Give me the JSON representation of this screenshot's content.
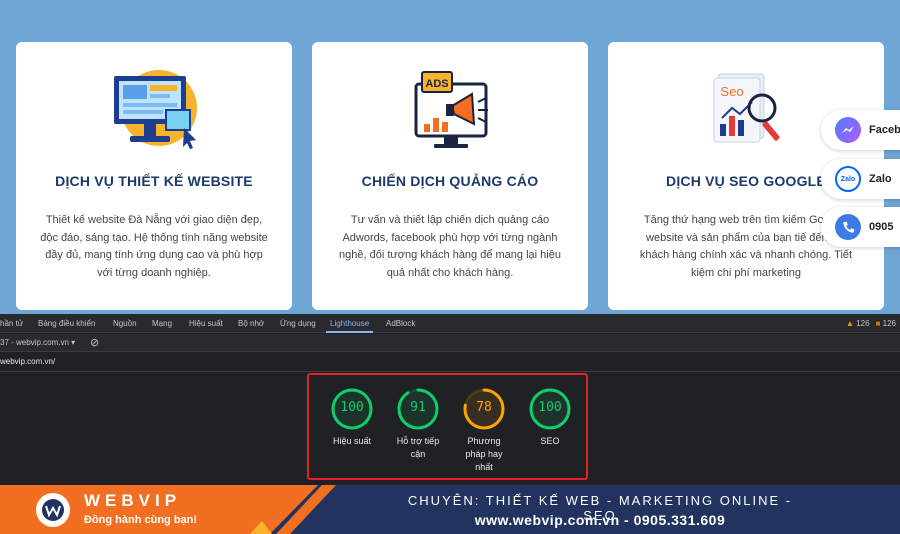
{
  "cards": [
    {
      "title": "DỊCH VỤ THIẾT KẾ WEBSITE",
      "desc": "Thiết kế website Đà Nẵng với giao diện đẹp, độc đáo, sáng tạo. Hệ thống tính năng website đầy đủ, mang tính ứng dụng cao và phù hợp với từng doanh nghiệp.",
      "icon": "monitor-website-icon"
    },
    {
      "title": "CHIẾN DỊCH QUẢNG CÁO",
      "desc": "Tư vấn và thiết lập chiến dịch quảng cáo Adwords, facebook phù hợp với từng ngành nghề, đối tượng khách hàng để mang lại hiệu quả nhất cho khách hàng.",
      "icon": "ads-megaphone-icon",
      "icon_text": "ADS"
    },
    {
      "title": "DỊCH VỤ SEO GOOGLE",
      "desc": "Tăng thứ hạng web trên tìm kiếm Go Đưa website và sản phẩm của bạn tiế đến tệp khách hàng chính xác và nhanh chóng. Tiết kiệm chi phí marketing",
      "icon": "seo-magnifier-icon",
      "icon_text": "Seo"
    }
  ],
  "contacts": {
    "facebook": "Faceb",
    "zalo": "Zalo",
    "zalo_icon_text": "Zalo",
    "phone": "0905"
  },
  "devtools": {
    "tabs": [
      "hần tử",
      "Bảng điều khiển",
      "Nguồn",
      "Mạng",
      "Hiệu suất",
      "Bộ nhớ",
      "Ứng dụng",
      "Lighthouse",
      "AdBlock"
    ],
    "active_tab": "Lighthouse",
    "warnings": "126",
    "messages": "126",
    "report_select": "37 - webvip.com.vn",
    "url": "webvip.com.vn/",
    "scores": [
      {
        "label": "Hiệu suất",
        "value": 100,
        "color": "#0cce6b"
      },
      {
        "label": "Hỗ trợ tiếp cận",
        "value": 91,
        "color": "#0cce6b"
      },
      {
        "label": "Phương pháp hay nhất",
        "value": 78,
        "color": "#ffa400"
      },
      {
        "label": "SEO",
        "value": 100,
        "color": "#0cce6b"
      }
    ]
  },
  "footer": {
    "brand": "WEBVIP",
    "slogan": "Đồng hành cùng bạn!",
    "tagline": "CHUYÊN: THIẾT KẾ WEB - MARKETING ONLINE - SEO",
    "contact": "www.webvip.com.vn - 0905.331.609"
  },
  "colors": {
    "sky": "#6fa5d5",
    "navy": "#1b3a6b",
    "orange": "#f26f21",
    "banner_navy": "#22335f",
    "pass": "#0cce6b",
    "average": "#ffa400",
    "highlight_border": "#e0222b"
  }
}
